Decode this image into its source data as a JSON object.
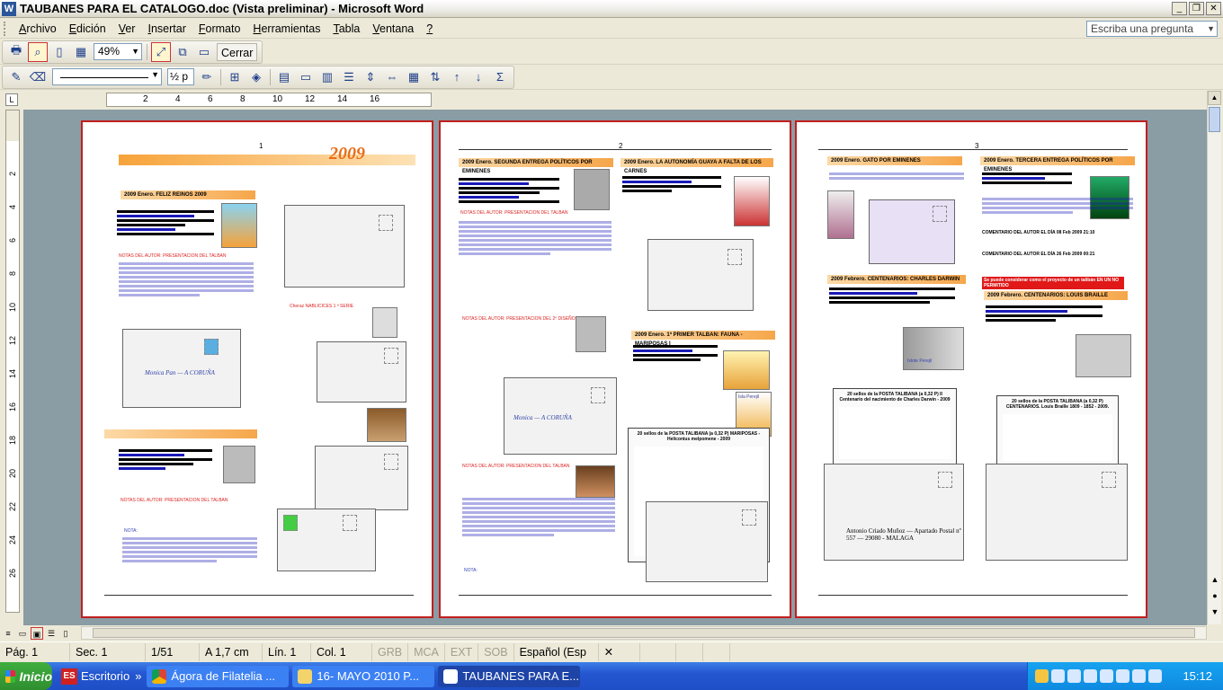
{
  "window": {
    "title": "TAUBANES PARA EL CATALOGO.doc (Vista preliminar) - Microsoft Word",
    "app_icon": "W",
    "controls": [
      "_",
      "❐",
      "✕"
    ]
  },
  "menu": {
    "items": [
      {
        "u": "A",
        "rest": "rchivo"
      },
      {
        "u": "E",
        "rest": "dición"
      },
      {
        "u": "V",
        "rest": "er"
      },
      {
        "u": "I",
        "rest": "nsertar"
      },
      {
        "u": "F",
        "rest": "ormato"
      },
      {
        "u": "H",
        "rest": "erramientas"
      },
      {
        "u": "T",
        "rest": "abla"
      },
      {
        "u": "V",
        "rest": "entana"
      },
      {
        "u": "?",
        "rest": ""
      }
    ],
    "ask_placeholder": "Escriba una pregunta"
  },
  "toolbar_preview": {
    "zoom": "49%",
    "close_label": "Cerrar"
  },
  "toolbar_drawing": {
    "line_weight": "½ p"
  },
  "ruler": {
    "h_numbers": [
      "2",
      "4",
      "6",
      "8",
      "10",
      "12",
      "14",
      "16"
    ],
    "v_numbers": [
      "2",
      "4",
      "6",
      "8",
      "10",
      "12",
      "14",
      "16",
      "18",
      "20",
      "22",
      "24",
      "26"
    ]
  },
  "pages": {
    "page1": {
      "number": "1",
      "year": "2009",
      "header1": "2009 Enero. FELIZ REINOS 2009",
      "author1": "NOTAS DEL AUTOR: PRESENTACION DEL TALBAN",
      "red_note": "Cheraz NABLICICES 1 ª SERIE",
      "author2": "NOTAS DEL AUTOR: PRESENTACION DEL TALBAN",
      "nota": "NOTA:",
      "envelope_hand": "Monica Pan — A CORUÑA"
    },
    "page2": {
      "number": "2",
      "header1": "2009 Enero. SEGUNDA ENTREGA POLÍTICOS POR EMINENES",
      "header2": "2009 Enero. LA AUTONOMÍA GUAYA A FALTA DE LOS CARNES",
      "header3": "2009 Enero. 1ª PRIMER TALBAN: FAUNA - MARIPOSAS I",
      "author1": "NOTAS DEL AUTOR: PRESENTACION DEL TALBAN",
      "author2": "NOTAS DEL AUTOR: PRESENTACION DEL 2º DISEÑO",
      "sheet_caption": "20 sellos de la POSTA TALIBANA (a 0,32 P) MARIPOSAS - Heliconius melpomene - 2009",
      "envelope_hand": "Monica — A CORUÑA",
      "stamp_label": "Isla Perejil",
      "nota": "NOTA:"
    },
    "page3": {
      "number": "3",
      "header1": "2009 Enero. GATO POR EMINENES",
      "header2": "2009 Enero. TERCERA ENTREGA POLÍTICOS POR EMINENES",
      "header3": "2009 Febrero. CENTENARIOS: CHARLES DARWIN",
      "header4": "2009 Febrero. CENTENARIOS: LOUIS BRAILLE",
      "comment1": "COMENTARIO DEL AUTOR EL DÍA 08 Feb 2009 21:10",
      "comment2": "COMENTARIO DEL AUTOR EL DÍA 26 Feb 2009 00:21",
      "red_banner": "Se puede considerar como el proyecto de un talibán EN UN NO PERMITIDO",
      "sheet1_caption": "20 sellos de la POSTA TALIBANA (a 0,32 P) II Centenario del nacimiento de Charles Darwin - 2009",
      "sheet2_caption": "20 sellos de la POSTA TALIBANA (a 0,32 P) CENTENARIOS. Louis Braille 1809 - 1852 - 2009.",
      "address": "Antonio Criado Muñoz — Apartado Postal nº 557 — 29080 - MALAGA",
      "stamp_label": "Islote Perejil"
    }
  },
  "status": {
    "page": "Pág. 1",
    "section": "Sec. 1",
    "pages": "1/51",
    "at": "A 1,7 cm",
    "line": "Lín. 1",
    "col": "Col. 1",
    "grb": "GRB",
    "mca": "MCA",
    "ext": "EXT",
    "sob": "SOB",
    "language": "Español (Esp"
  },
  "taskbar": {
    "start": "Inicio",
    "quick_label": "Escritorio",
    "lang_indicator": "ES",
    "tasks": [
      {
        "label": "Ágora de Filatelia ...",
        "color": "#e9a31a"
      },
      {
        "label": "16- MAYO 2010 P...",
        "color": "#f3d36b"
      },
      {
        "label": "TAUBANES PARA E...",
        "color": "#2b579a"
      }
    ],
    "clock": "15:12"
  }
}
